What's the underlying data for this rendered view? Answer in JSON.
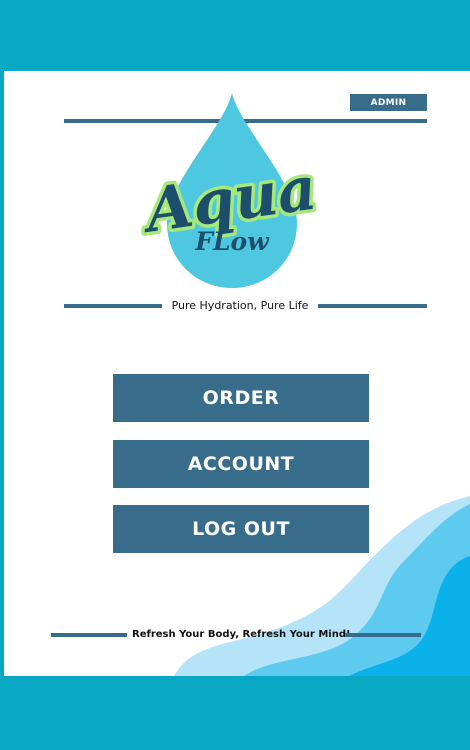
{
  "header": {
    "admin_badge": "ADMIN"
  },
  "logo": {
    "title": "Aqua",
    "subtitle": "FLow",
    "colors": {
      "drop": "#4dc8e0",
      "text": "#1d4e6c",
      "glow": "#a6e87b"
    }
  },
  "tagline": "Pure Hydration, Pure Life",
  "menu": {
    "items": [
      {
        "label": "ORDER"
      },
      {
        "label": "ACCOUNT"
      },
      {
        "label": "LOG OUT"
      }
    ]
  },
  "footer": {
    "text": "Refresh Your Body, Refresh Your Mind!"
  },
  "theme": {
    "background": "#08a8c4",
    "card": "#ffffff",
    "accent": "#376c8a",
    "wave_light": "#b5e3f8",
    "wave_mid": "#5fcaef",
    "wave_dark": "#0bb2ea"
  }
}
